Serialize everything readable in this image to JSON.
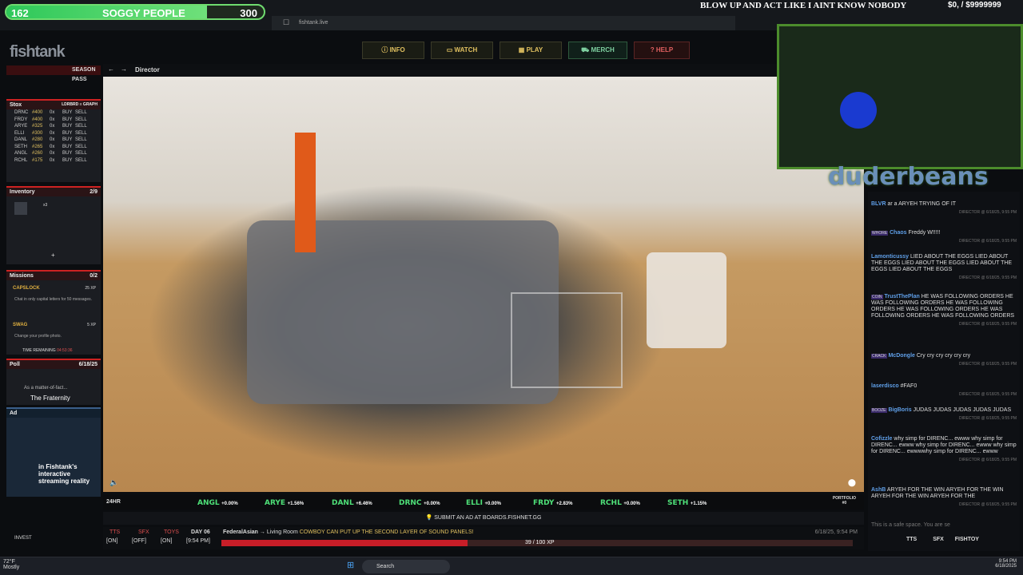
{
  "overlay": {
    "level": "162",
    "name": "SOGGY PEOPLE",
    "value": "300",
    "headline": "BLOW UP AND ACT LIKE I AINT KNOW NOBODY",
    "money": "$0, / $9999999",
    "level_progress": 0.78
  },
  "browser": {
    "url": "fishtank.live"
  },
  "logo": "fishtank",
  "nav": [
    {
      "label": "INFO",
      "color": "#e0c060"
    },
    {
      "label": "WATCH",
      "color": "#e0c060"
    },
    {
      "label": "PLAY",
      "color": "#e0c060"
    },
    {
      "label": "MERCH",
      "color": "#7ed0a0"
    },
    {
      "label": "HELP",
      "color": "#e06060"
    }
  ],
  "season_pass": "SEASON PASS",
  "stox": {
    "title": "Stox",
    "sub": "LDRBRD ≡ GRAPH",
    "items": [
      {
        "name": "DRNC",
        "price": "#400",
        "qty": "0x",
        "buy": "BUY",
        "sell": "SELL"
      },
      {
        "name": "FRDY",
        "price": "#400",
        "qty": "0x",
        "buy": "BUY",
        "sell": "SELL"
      },
      {
        "name": "ARYE",
        "price": "#325",
        "qty": "0x",
        "buy": "BUY",
        "sell": "SELL"
      },
      {
        "name": "ELLI",
        "price": "#300",
        "qty": "0x",
        "buy": "BUY",
        "sell": "SELL"
      },
      {
        "name": "DANL",
        "price": "#280",
        "qty": "0x",
        "buy": "BUY",
        "sell": "SELL"
      },
      {
        "name": "SETH",
        "price": "#265",
        "qty": "0x",
        "buy": "BUY",
        "sell": "SELL"
      },
      {
        "name": "ANGL",
        "price": "#260",
        "qty": "0x",
        "buy": "BUY",
        "sell": "SELL"
      },
      {
        "name": "RCHL",
        "price": "#175",
        "qty": "0x",
        "buy": "BUY",
        "sell": "SELL"
      }
    ]
  },
  "inventory": {
    "title": "Inventory",
    "count": "2/9",
    "item_qty": "x3",
    "add": "+"
  },
  "missions": {
    "title": "Missions",
    "count": "0/2",
    "items": [
      {
        "name": "CAPSLOCK",
        "xp": "25 XP",
        "desc": "Chat in only capital letters for 50 messages."
      },
      {
        "name": "SWAG",
        "xp": "5 XP",
        "desc": "Change your profile photo."
      }
    ],
    "time_label": "TIME REMAINING",
    "time": "04:53:36"
  },
  "poll": {
    "title": "Poll",
    "date": "6/18/25",
    "q": "As a matter-of-fact...",
    "a": "The Fraternity"
  },
  "ad": {
    "title": "Ad",
    "text": "in Fishtank's interactive streaming reality"
  },
  "video": {
    "title": "Director",
    "timestamp": "24HR"
  },
  "ticker": [
    {
      "n": "ANGL",
      "v": "+0.00%"
    },
    {
      "n": "ARYE",
      "v": "+1.56%"
    },
    {
      "n": "DANL",
      "v": "+6.46%"
    },
    {
      "n": "DRNC",
      "v": "+0.00%"
    },
    {
      "n": "ELLI",
      "v": "+0.00%"
    },
    {
      "n": "FRDY",
      "v": "+2.83%"
    },
    {
      "n": "RCHL",
      "v": "+0.00%"
    },
    {
      "n": "SETH",
      "v": "+1.15%"
    }
  ],
  "portfolio": {
    "label": "PORTFOLIO",
    "val": "#0"
  },
  "submit_ad": "SUBMIT AN AD AT BOARDS.FISHNET.GG",
  "bottom": {
    "tts": "TTS",
    "tts_state": "[ON]",
    "sfx": "SFX",
    "sfx_state": "[OFF]",
    "toys": "TOYS",
    "toys_state": "[ON]",
    "day": "DAY 06",
    "time": "[9:54 PM]",
    "user": "FederalAsian",
    "arrow": "→",
    "room": "Living Room",
    "msg": "COWBOY CAN PUT UP THE SECOND LAYER OF SOUND PANELS!",
    "xp": "39 / 100 XP",
    "stamp": "6/18/25, 9:54 PM",
    "invest": "INVEST"
  },
  "chat": {
    "messages": [
      {
        "badge": "",
        "user": "BLVR",
        "text": "ar a ARYEH TRYING OF IT"
      },
      {
        "badge": "WHORE",
        "user": "Chaos",
        "text": "Freddy W!!!!!"
      },
      {
        "badge": "",
        "user": "Lamonticussy",
        "text": "LIED ABOUT THE EGGS LIED ABOUT THE EGGS LIED ABOUT THE EGGS LIED ABOUT THE EGGS LIED ABOUT THE EGGS"
      },
      {
        "badge": "COIN",
        "user": "TrustThePlan",
        "text": "HE WAS FOLLOWING ORDERS HE WAS FOLLOWING ORDERS HE WAS FOLLOWING ORDERS HE WAS FOLLOWING ORDERS HE WAS FOLLOWING ORDERS HE WAS FOLLOWING ORDERS"
      },
      {
        "badge": "CRACK",
        "user": "McDongle",
        "text": "Cry cry cry cry cry cry"
      },
      {
        "badge": "",
        "user": "laserdisco",
        "text": "#FAF0"
      },
      {
        "badge": "BOOZE",
        "user": "BigBoris",
        "text": "JUDAS JUDAS JUDAS JUDAS JUDAS"
      },
      {
        "badge": "",
        "user": "Cofizzle",
        "text": "why simp for DIRENC... ewww why simp for DIRENC... ewww why simp for DIRENC... ewww why simp for DIRENC... ewwwwhy simp for DIRENC... ewww"
      },
      {
        "badge": "",
        "user": "AshB",
        "text": "ARYEH FOR THE WIN ARYEH FOR THE WIN ARYEH FOR THE WIN ARYEH FOR THE"
      }
    ],
    "meta": "DIRECTOR @ 6/18/25, 9:55 PM",
    "placeholder": "This is a safe space. You are se",
    "tools": [
      "TTS",
      "SFX",
      "FISHTOY"
    ]
  },
  "streamer": "duderbeans",
  "taskbar": {
    "search": "Search",
    "time": "9:54 PM",
    "date": "6/18/2025",
    "weather": "72°F",
    "weather_sub": "Mostly"
  }
}
